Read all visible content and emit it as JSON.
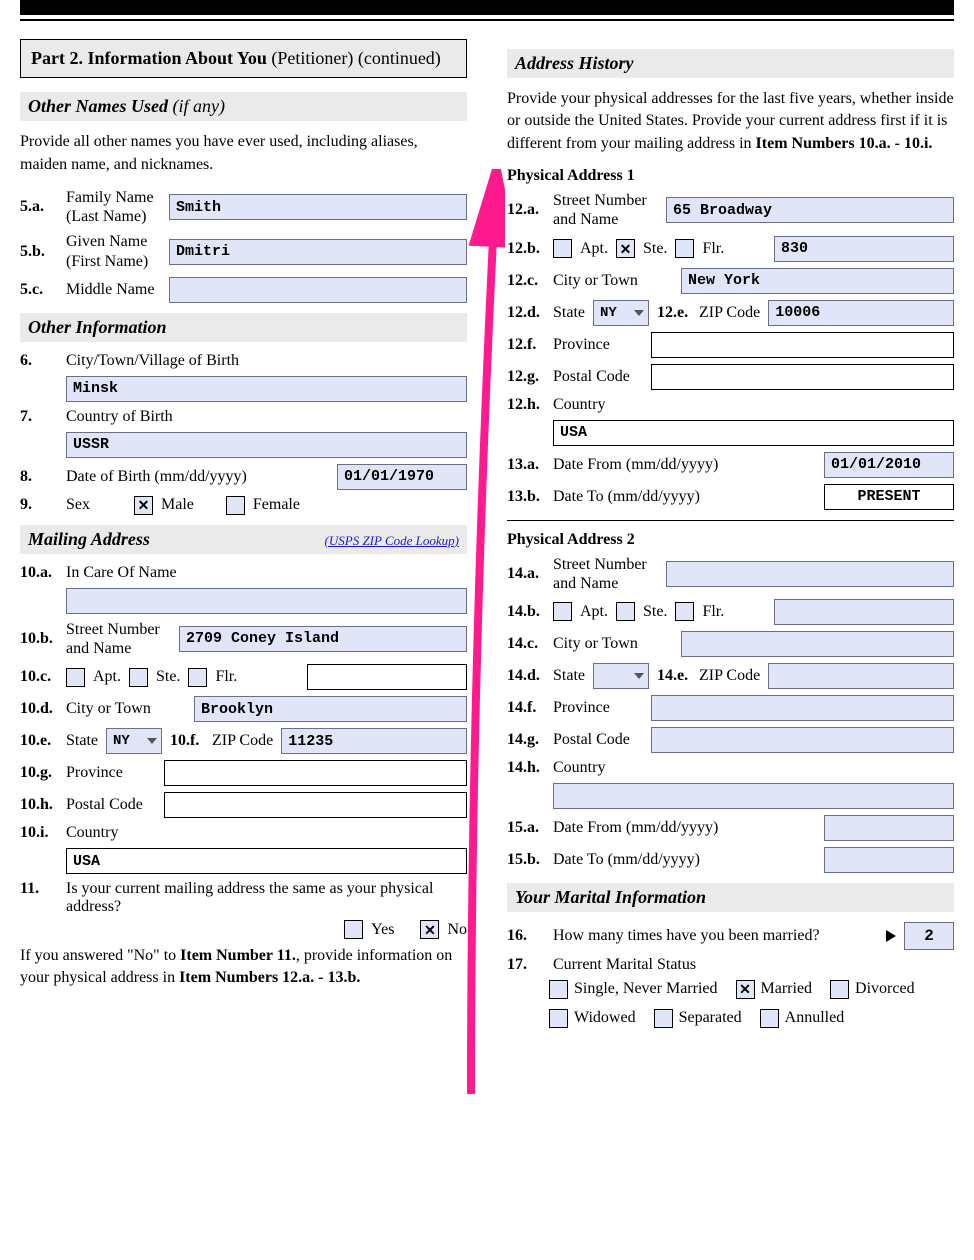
{
  "part_header_bold": "Part 2.  Information About You",
  "part_header_plain": " (Petitioner) (continued)",
  "other_names": {
    "header": "Other Names Used",
    "header_suffix": " (if any)",
    "instr": "Provide all other names you have ever used, including aliases, maiden name, and nicknames.",
    "a_num": "5.a.",
    "a_label1": "Family Name",
    "a_label2": "(Last Name)",
    "a_val": "Smith",
    "b_num": "5.b.",
    "b_label1": "Given Name",
    "b_label2": "(First Name)",
    "b_val": "Dmitri",
    "c_num": "5.c.",
    "c_label": "Middle Name",
    "c_val": ""
  },
  "other_info": {
    "header": "Other Information",
    "q6_num": "6.",
    "q6_label": "City/Town/Village of Birth",
    "q6_val": "Minsk",
    "q7_num": "7.",
    "q7_label": "Country of Birth",
    "q7_val": "USSR",
    "q8_num": "8.",
    "q8_label": "Date of Birth (mm/dd/yyyy)",
    "q8_val": "01/01/1970",
    "q9_num": "9.",
    "q9_label": "Sex",
    "q9_male": "Male",
    "q9_female": "Female"
  },
  "mailing": {
    "header": "Mailing Address",
    "link": "(USPS ZIP Code Lookup)",
    "a_num": "10.a.",
    "a_label": "In Care Of Name",
    "a_val": "",
    "b_num": "10.b.",
    "b_label1": "Street Number",
    "b_label2": "and Name",
    "b_val": "2709 Coney Island",
    "c_num": "10.c.",
    "c_apt": "Apt.",
    "c_ste": "Ste.",
    "c_flr": "Flr.",
    "c_val": "",
    "d_num": "10.d.",
    "d_label": "City or Town",
    "d_val": "Brooklyn",
    "e_num": "10.e.",
    "e_label": "State",
    "e_val": "NY",
    "f_num": "10.f.",
    "f_label": "ZIP Code",
    "f_val": "11235",
    "g_num": "10.g.",
    "g_label": "Province",
    "g_val": "",
    "h_num": "10.h.",
    "h_label": "Postal Code",
    "h_val": "",
    "i_num": "10.i.",
    "i_label": "Country",
    "i_val": "USA",
    "q11_num": "11.",
    "q11_text": "Is your current mailing address the same as your physical address?",
    "q11_yes": "Yes",
    "q11_no": "No",
    "q11_note_pre": "If you answered \"No\" to ",
    "q11_note_bold1": "Item Number 11.",
    "q11_note_mid": ", provide information on your physical address in ",
    "q11_note_bold2": "Item Numbers 12.a. - 13.b."
  },
  "addr_hist": {
    "header": "Address History",
    "instr_pre": "Provide your physical addresses for the last five years, whether inside or outside the United States.  Provide your current address first if it is different from your mailing address in ",
    "instr_bold": "Item Numbers 10.a. - 10.i.",
    "p1_title": "Physical Address 1",
    "p2_title": "Physical Address 2"
  },
  "p1": {
    "a_num": "12.a.",
    "a_label1": "Street Number",
    "a_label2": "and Name",
    "a_val": "65 Broadway",
    "b_num": "12.b.",
    "b_apt": "Apt.",
    "b_ste": "Ste.",
    "b_flr": "Flr.",
    "b_val": "830",
    "c_num": "12.c.",
    "c_label": "City or Town",
    "c_val": "New York",
    "d_num": "12.d.",
    "d_label": "State",
    "d_val": "NY",
    "e_num": "12.e.",
    "e_label": "ZIP Code",
    "e_val": "10006",
    "f_num": "12.f.",
    "f_label": "Province",
    "f_val": "",
    "g_num": "12.g.",
    "g_label": "Postal Code",
    "g_val": "",
    "h_num": "12.h.",
    "h_label": "Country",
    "h_val": "USA",
    "from_num": "13.a.",
    "from_label": "Date From (mm/dd/yyyy)",
    "from_val": "01/01/2010",
    "to_num": "13.b.",
    "to_label": "Date To (mm/dd/yyyy)",
    "to_val": "PRESENT"
  },
  "p2": {
    "a_num": "14.a.",
    "a_label1": "Street Number",
    "a_label2": "and Name",
    "a_val": "",
    "b_num": "14.b.",
    "b_apt": "Apt.",
    "b_ste": "Ste.",
    "b_flr": "Flr.",
    "b_val": "",
    "c_num": "14.c.",
    "c_label": "City or Town",
    "c_val": "",
    "d_num": "14.d.",
    "d_label": "State",
    "d_val": "",
    "e_num": "14.e.",
    "e_label": "ZIP Code",
    "e_val": "",
    "f_num": "14.f.",
    "f_label": "Province",
    "f_val": "",
    "g_num": "14.g.",
    "g_label": "Postal Code",
    "g_val": "",
    "h_num": "14.h.",
    "h_label": "Country",
    "h_val": "",
    "from_num": "15.a.",
    "from_label": "Date From (mm/dd/yyyy)",
    "from_val": "",
    "to_num": "15.b.",
    "to_label": "Date To (mm/dd/yyyy)",
    "to_val": ""
  },
  "marital": {
    "header": "Your Marital Information",
    "q16_num": "16.",
    "q16_text": "How many times have you been married?",
    "q16_val": "2",
    "q17_num": "17.",
    "q17_text": "Current Marital Status",
    "single": "Single, Never Married",
    "married": "Married",
    "divorced": "Divorced",
    "widowed": "Widowed",
    "separated": "Separated",
    "annulled": "Annulled"
  }
}
